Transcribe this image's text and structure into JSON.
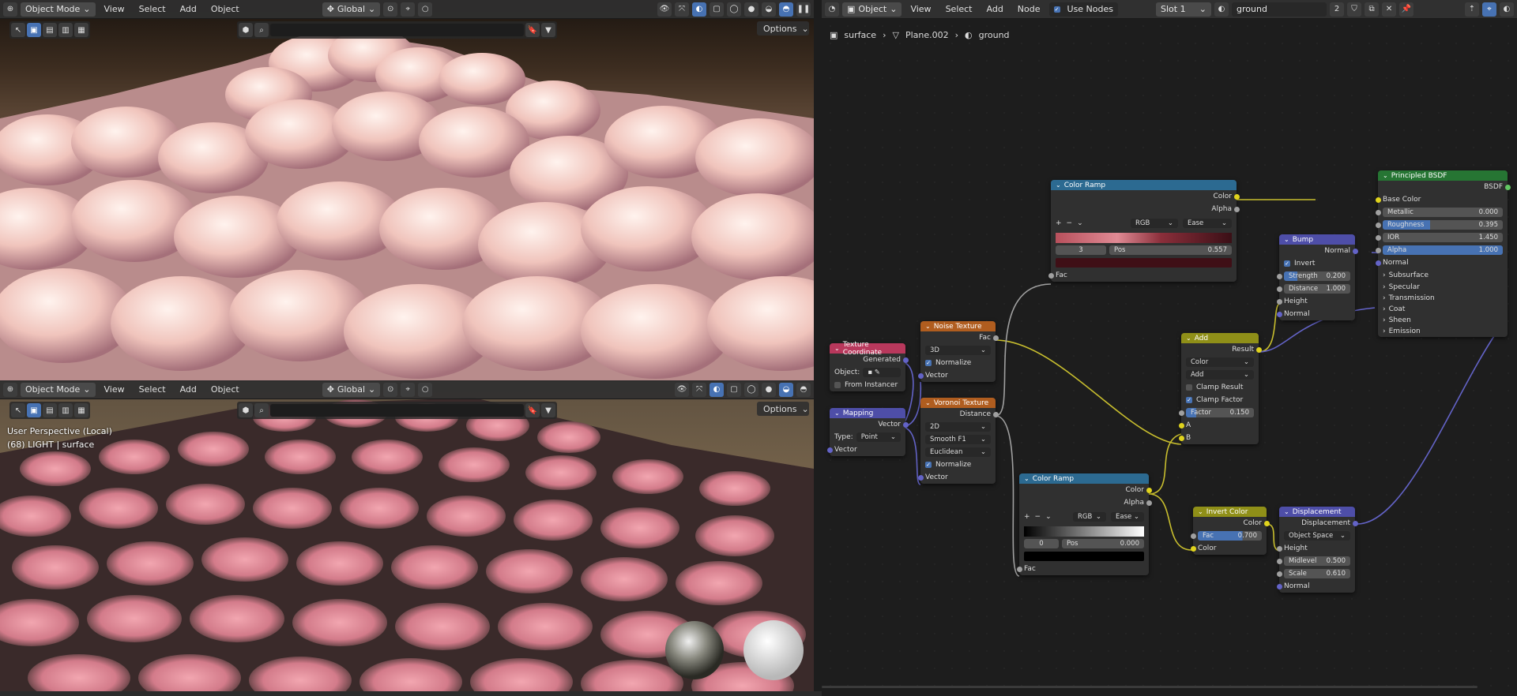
{
  "viewport_top": {
    "mode": "Object Mode",
    "menus": [
      "View",
      "Select",
      "Add",
      "Object"
    ],
    "transform": "Global",
    "options": "Options"
  },
  "viewport_bottom": {
    "mode": "Object Mode",
    "menus": [
      "View",
      "Select",
      "Add",
      "Object"
    ],
    "transform": "Global",
    "options": "Options",
    "overlay_line1": "User Perspective (Local)",
    "overlay_line2": "(68) LIGHT | surface"
  },
  "node_editor": {
    "type": "Object",
    "menus": [
      "View",
      "Select",
      "Add",
      "Node"
    ],
    "use_nodes": "Use Nodes",
    "slot": "Slot 1",
    "material": "ground",
    "users": "2",
    "breadcrumb": [
      "surface",
      "Plane.002",
      "ground"
    ]
  },
  "nodes": {
    "texcoord": {
      "title": "Texture Coordinate",
      "out": "Generated",
      "object_label": "Object:",
      "from_instancer": "From Instancer"
    },
    "mapping": {
      "title": "Mapping",
      "out": "Vector",
      "type_label": "Type:",
      "type": "Point",
      "in": "Vector"
    },
    "noise": {
      "title": "Noise Texture",
      "out": "Fac",
      "dim": "3D",
      "normalize": "Normalize",
      "in": "Vector"
    },
    "voronoi": {
      "title": "Voronoi Texture",
      "out": "Distance",
      "dim": "2D",
      "feature": "Smooth F1",
      "metric": "Euclidean",
      "normalize": "Normalize",
      "in": "Vector"
    },
    "ramp1": {
      "title": "Color Ramp",
      "out_color": "Color",
      "out_alpha": "Alpha",
      "mode": "RGB",
      "interp": "Ease",
      "index": "3",
      "pos_label": "Pos",
      "pos": "0.557",
      "in": "Fac"
    },
    "ramp2": {
      "title": "Color Ramp",
      "out_color": "Color",
      "out_alpha": "Alpha",
      "mode": "RGB",
      "interp": "Ease",
      "index": "0",
      "pos_label": "Pos",
      "pos": "0.000",
      "in": "Fac"
    },
    "add": {
      "title": "Add",
      "out": "Result",
      "type": "Color",
      "op": "Add",
      "clamp_result": "Clamp Result",
      "clamp_factor": "Clamp Factor",
      "factor_label": "Factor",
      "factor": "0.150",
      "a": "A",
      "b": "B"
    },
    "invert": {
      "title": "Invert Color",
      "out": "Color",
      "fac_label": "Fac",
      "fac": "0.700",
      "in": "Color"
    },
    "bump": {
      "title": "Bump",
      "out": "Normal",
      "invert": "Invert",
      "strength_label": "Strength",
      "strength": "0.200",
      "distance_label": "Distance",
      "distance": "1.000",
      "height": "Height",
      "normal": "Normal"
    },
    "disp": {
      "title": "Displacement",
      "out": "Displacement",
      "space": "Object Space",
      "height": "Height",
      "mid_label": "Midlevel",
      "mid": "0.500",
      "scale_label": "Scale",
      "scale": "0.610",
      "normal": "Normal"
    },
    "bsdf": {
      "title": "Principled BSDF",
      "out": "BSDF",
      "base": "Base Color",
      "metal_label": "Metallic",
      "metal": "0.000",
      "rough_label": "Roughness",
      "rough": "0.395",
      "ior_label": "IOR",
      "ior": "1.450",
      "alpha_label": "Alpha",
      "alpha": "1.000",
      "normal": "Normal",
      "panels": [
        "Subsurface",
        "Specular",
        "Transmission",
        "Coat",
        "Sheen",
        "Emission"
      ]
    }
  },
  "colors": {
    "accent": "#4772b3",
    "header_texture": "#a13a55",
    "header_converter": "#2c6a91",
    "header_vector": "#4e4ea8",
    "header_color": "#8f8f18",
    "header_shader": "#267533",
    "header_input": "#b8385c"
  }
}
